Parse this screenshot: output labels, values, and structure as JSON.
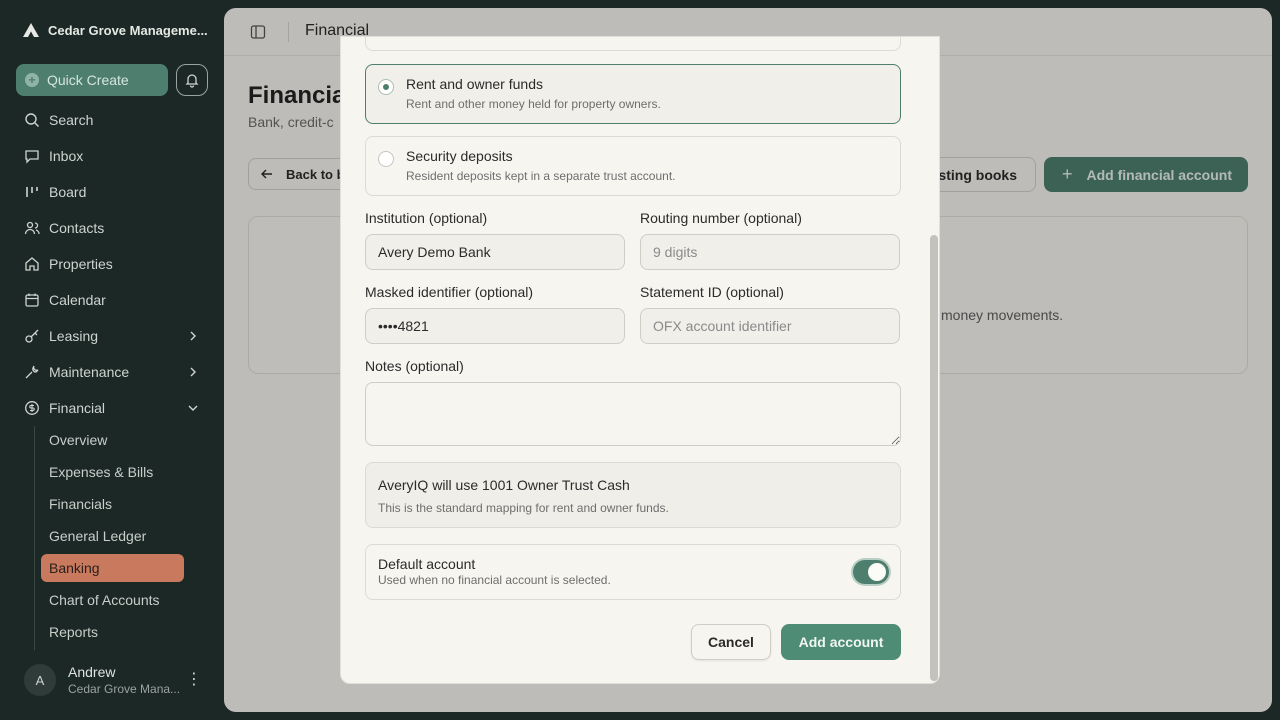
{
  "sidebar": {
    "org_name": "Cedar Grove Manageme...",
    "quick_create": "Quick Create",
    "nav": {
      "search": "Search",
      "inbox": "Inbox",
      "board": "Board",
      "contacts": "Contacts",
      "properties": "Properties",
      "calendar": "Calendar",
      "leasing": "Leasing",
      "maintenance": "Maintenance",
      "financial": "Financial"
    },
    "financial_sub": [
      "Overview",
      "Expenses & Bills",
      "Financials",
      "General Ledger",
      "Banking",
      "Chart of Accounts",
      "Reports"
    ],
    "active_sub": "Banking",
    "user": {
      "initial": "A",
      "name": "Andrew",
      "org": "Cedar Grove Mana..."
    }
  },
  "main": {
    "breadcrumb": "Financial",
    "title": "Financia",
    "subtitle": "Bank, credit-c",
    "back_button": "Back to b",
    "books_button": "isting books",
    "add_button": "Add financial account",
    "card_text": "money movements."
  },
  "modal": {
    "options": [
      {
        "title": "Rent and owner funds",
        "desc": "Rent and other money held for property owners.",
        "selected": true
      },
      {
        "title": "Security deposits",
        "desc": "Resident deposits kept in a separate trust account.",
        "selected": false
      }
    ],
    "fields": {
      "institution": {
        "label": "Institution (optional)",
        "value": "Avery Demo Bank",
        "placeholder": ""
      },
      "routing": {
        "label": "Routing number (optional)",
        "value": "",
        "placeholder": "9 digits"
      },
      "masked": {
        "label": "Masked identifier (optional)",
        "value": "••••4821",
        "placeholder": ""
      },
      "statement": {
        "label": "Statement ID (optional)",
        "value": "",
        "placeholder": "OFX account identifier"
      },
      "notes": {
        "label": "Notes (optional)",
        "value": ""
      }
    },
    "mapping": {
      "title": "AveryIQ will use 1001 Owner Trust Cash",
      "desc": "This is the standard mapping for rent and owner funds."
    },
    "default_account": {
      "title": "Default account",
      "desc": "Used when no financial account is selected.",
      "enabled": true
    },
    "cancel_label": "Cancel",
    "submit_label": "Add account"
  },
  "colors": {
    "accent": "#4e7e6e",
    "active_nav": "#c97a5e",
    "sidebar_bg": "#1b2826"
  }
}
